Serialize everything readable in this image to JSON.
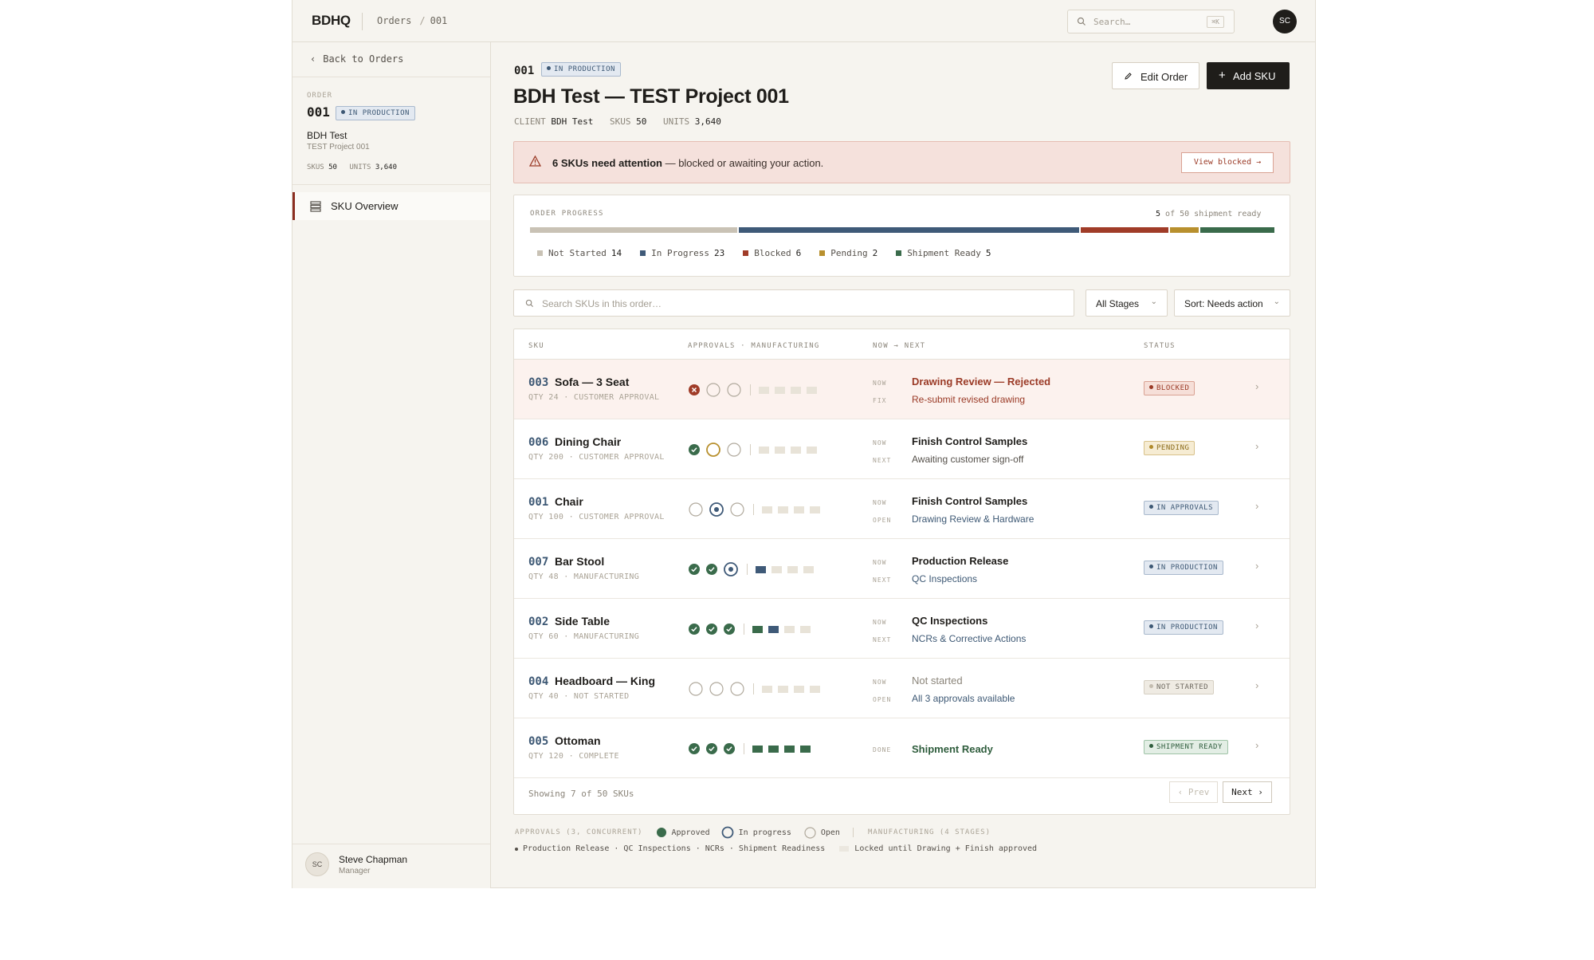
{
  "topbar": {
    "logo": "BDHQ",
    "breadcrumb": [
      "Orders",
      "001"
    ],
    "breadcrumb_sep": "/",
    "search_placeholder": "Search…",
    "search_shortcut": "⌘K",
    "avatar_initials": "SC"
  },
  "sidebar": {
    "back_label": "Back to Orders",
    "eyebrow": "ORDER",
    "order_number": "001",
    "order_status": "IN PRODUCTION",
    "client": "BDH Test",
    "project": "TEST Project 001",
    "skus_label": "SKUS",
    "skus_value": "50",
    "units_label": "UNITS",
    "units_value": "3,640",
    "nav_item": "SKU Overview",
    "user_initials": "SC",
    "user_name": "Steve Chapman",
    "user_role": "Manager"
  },
  "header": {
    "order_number": "001",
    "status": "IN PRODUCTION",
    "title": "BDH Test — TEST Project 001",
    "client_label": "CLIENT",
    "client_value": "BDH Test",
    "skus_label": "SKUS",
    "skus_value": "50",
    "units_label": "UNITS",
    "units_value": "3,640",
    "edit_button": "Edit Order",
    "add_button": "Add SKU"
  },
  "alert": {
    "bold": "6 SKUs need attention",
    "rest": " — blocked or awaiting your action.",
    "button": "View blocked →"
  },
  "progress": {
    "eyebrow": "ORDER PROGRESS",
    "ready_count": "5",
    "ready_text": " of 50 shipment ready",
    "segments": [
      {
        "label": "Not Started",
        "count": 14,
        "color": "#c9c2b5"
      },
      {
        "label": "In Progress",
        "count": 23,
        "color": "#3f5a78"
      },
      {
        "label": "Blocked",
        "count": 6,
        "color": "#a03c28"
      },
      {
        "label": "Pending",
        "count": 2,
        "color": "#b8902e"
      },
      {
        "label": "Shipment Ready",
        "count": 5,
        "color": "#3a6b4b"
      }
    ]
  },
  "filters": {
    "search_placeholder": "Search SKUs in this order…",
    "stage_select": "All Stages",
    "sort_select": "Sort: Needs action"
  },
  "table": {
    "headers": {
      "sku": "SKU",
      "approvals": "APPROVALS · MANUFACTURING",
      "now_next": "NOW → NEXT",
      "status": "STATUS"
    },
    "rows": [
      {
        "id": "003",
        "name": "Sofa — 3 Seat",
        "meta": "QTY 24 · CUSTOMER APPROVAL",
        "approvals": [
          "rejected",
          "open",
          "open"
        ],
        "mfg": [
          0,
          0,
          0,
          0
        ],
        "label1": "NOW",
        "now": "Drawing Review — Rejected",
        "now_style": "red",
        "label2": "FIX",
        "next": "Re-submit revised drawing",
        "next_style": "red",
        "status": "BLOCKED",
        "status_class": "b-blocked",
        "highlight": true
      },
      {
        "id": "006",
        "name": "Dining Chair",
        "meta": "QTY 200 · CUSTOMER APPROVAL",
        "approvals": [
          "approved",
          "pending",
          "open"
        ],
        "mfg": [
          0,
          0,
          0,
          0
        ],
        "label1": "NOW",
        "now": "Finish Control Samples",
        "now_style": "",
        "label2": "NEXT",
        "next": "Awaiting customer sign-off",
        "next_style": "",
        "status": "PENDING",
        "status_class": "b-pending",
        "highlight": false
      },
      {
        "id": "001",
        "name": "Chair",
        "meta": "QTY 100 · CUSTOMER APPROVAL",
        "approvals": [
          "open",
          "progress",
          "open"
        ],
        "mfg": [
          0,
          0,
          0,
          0
        ],
        "label1": "NOW",
        "now": "Finish Control Samples",
        "now_style": "",
        "label2": "OPEN",
        "next": "Drawing Review & Hardware",
        "next_style": "link",
        "status": "IN APPROVALS",
        "status_class": "b-prod",
        "highlight": false
      },
      {
        "id": "007",
        "name": "Bar Stool",
        "meta": "QTY 48 · MANUFACTURING",
        "approvals": [
          "approved",
          "approved",
          "progress"
        ],
        "mfg": [
          1,
          0,
          0,
          0
        ],
        "label1": "NOW",
        "now": "Production Release",
        "now_style": "",
        "label2": "NEXT",
        "next": "QC Inspections",
        "next_style": "link",
        "status": "IN PRODUCTION",
        "status_class": "b-prod",
        "highlight": false
      },
      {
        "id": "002",
        "name": "Side Table",
        "meta": "QTY 60 · MANUFACTURING",
        "approvals": [
          "approved",
          "approved",
          "approved"
        ],
        "mfg": [
          2,
          1,
          0,
          0
        ],
        "label1": "NOW",
        "now": "QC Inspections",
        "now_style": "",
        "label2": "NEXT",
        "next": "NCRs & Corrective Actions",
        "next_style": "link",
        "status": "IN PRODUCTION",
        "status_class": "b-prod",
        "highlight": false
      },
      {
        "id": "004",
        "name": "Headboard — King",
        "meta": "QTY 40 · NOT STARTED",
        "approvals": [
          "open",
          "open",
          "open"
        ],
        "mfg": [
          0,
          0,
          0,
          0
        ],
        "label1": "NOW",
        "now": "Not started",
        "now_style": "grey",
        "label2": "OPEN",
        "next": "All 3 approvals available",
        "next_style": "link",
        "status": "NOT STARTED",
        "status_class": "b-ns",
        "highlight": false
      },
      {
        "id": "005",
        "name": "Ottoman",
        "meta": "QTY 120 · COMPLETE",
        "approvals": [
          "approved",
          "approved",
          "approved"
        ],
        "mfg": [
          2,
          2,
          2,
          2
        ],
        "label1": "DONE",
        "now": "Shipment Ready",
        "now_style": "green",
        "label2": "",
        "next": "",
        "next_style": "",
        "status": "SHIPMENT READY",
        "status_class": "b-ready",
        "highlight": false
      }
    ],
    "footer_text": "Showing 7 of 50 SKUs",
    "prev": "‹ Prev",
    "next": "Next ›"
  },
  "legend": {
    "approvals_caption": "APPROVALS (3, CONCURRENT)",
    "approved": "Approved",
    "in_progress": "In progress",
    "open": "Open",
    "mfg_caption": "MANUFACTURING (4 STAGES)",
    "mfg_stages": "Production Release · QC Inspections · NCRs · Shipment Readiness",
    "locked": "Locked until Drawing + Finish approved"
  },
  "colors": {
    "accent_red": "#8b2e21",
    "green": "#3a6b4b",
    "navy": "#3f5a78",
    "amber": "#b8902e"
  }
}
